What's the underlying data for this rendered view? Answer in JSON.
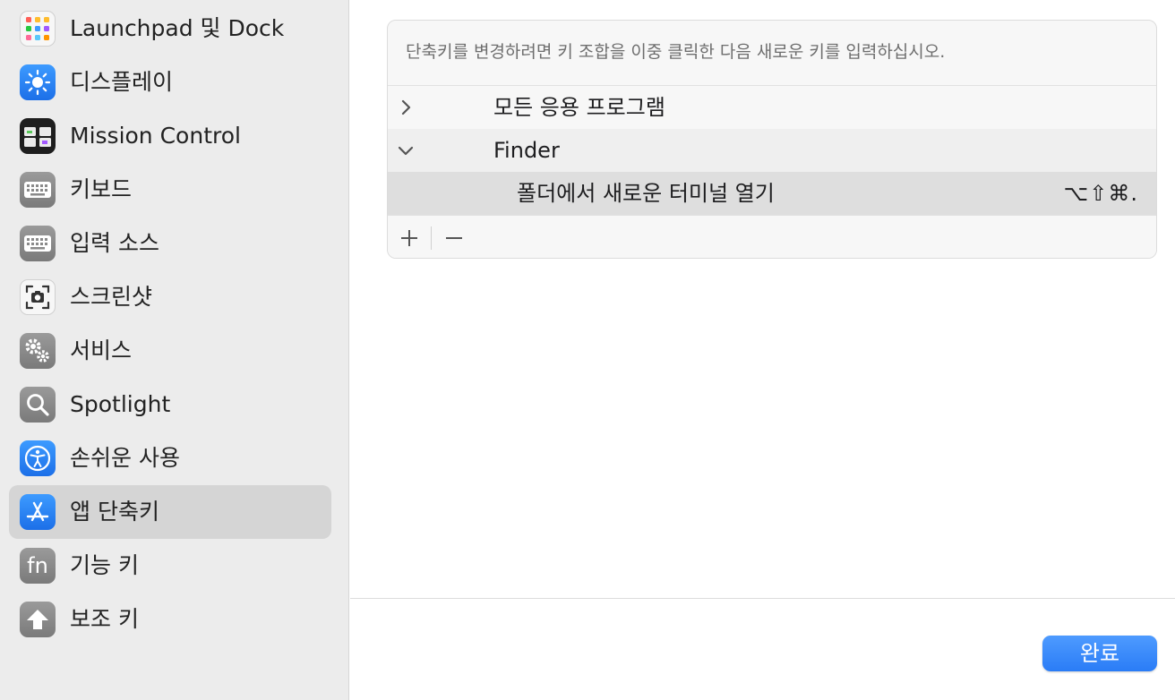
{
  "sidebar": {
    "items": [
      {
        "label": "Launchpad 및 Dock",
        "icon": "launchpad-icon"
      },
      {
        "label": "디스플레이",
        "icon": "display-brightness-icon"
      },
      {
        "label": "Mission Control",
        "icon": "mission-control-icon"
      },
      {
        "label": "키보드",
        "icon": "keyboard-icon"
      },
      {
        "label": "입력 소스",
        "icon": "input-sources-icon"
      },
      {
        "label": "스크린샷",
        "icon": "screenshot-camera-icon"
      },
      {
        "label": "서비스",
        "icon": "services-gears-icon"
      },
      {
        "label": "Spotlight",
        "icon": "spotlight-magnifier-icon"
      },
      {
        "label": "손쉬운 사용",
        "icon": "accessibility-icon"
      },
      {
        "label": "앱 단축키",
        "icon": "app-store-icon",
        "selected": true
      },
      {
        "label": "기능 키",
        "icon": "fn-key-icon"
      },
      {
        "label": "보조 키",
        "icon": "modifier-key-icon"
      }
    ]
  },
  "main": {
    "instruction": "단축키를 변경하려면 키 조합을 이중 클릭한 다음 새로운 키를 입력하십시오.",
    "rows": [
      {
        "label": "모든 응용 프로그램",
        "expanded": false
      },
      {
        "label": "Finder",
        "expanded": true
      },
      {
        "label": "폴더에서 새로운 터미널 열기",
        "shortcut": "⌥⇧⌘."
      }
    ],
    "toolbar": {
      "add_icon": "plus-icon",
      "remove_icon": "minus-icon"
    }
  },
  "footer": {
    "done_label": "완료"
  },
  "colors": {
    "accent": "#2a7cf6",
    "selection": "#d5d5d5",
    "sidebar_bg": "#ececec"
  }
}
